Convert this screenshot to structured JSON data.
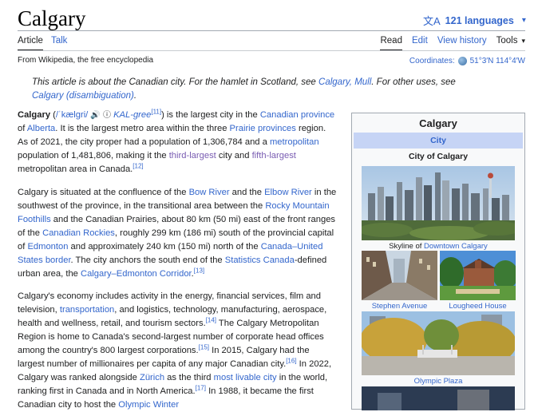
{
  "page": {
    "title": "Calgary",
    "languages_label": "121 languages",
    "tabs_left": [
      "Article",
      "Talk"
    ],
    "tabs_right": [
      "Read",
      "Edit",
      "View history"
    ],
    "tools_label": "Tools",
    "tagline": "From Wikipedia, the free encyclopedia",
    "coordinates_label": "Coordinates:",
    "coordinates_value": "51°3′N 114°4′W"
  },
  "hatnote": {
    "t1": "This article is about the Canadian city. For the hamlet in Scotland, see ",
    "l1": "Calgary, Mull",
    "t2": ". For other uses, see ",
    "l2": "Calgary (disambiguation)",
    "t3": "."
  },
  "para1": {
    "bold": "Calgary",
    "t1": " (",
    "ipa": "/ˈkælɡri/",
    "t2": " ",
    "pron": "KAL-gree",
    "ref1": "[11]",
    "t3": ") is the largest city in the ",
    "l1": "Canadian province",
    "t4": " of ",
    "l2": "Alberta",
    "t5": ". It is the largest metro area within the three ",
    "l3": "Prairie provinces",
    "t6": " region. As of 2021, the city proper had a population of 1,306,784 and a ",
    "l4": "metropolitan",
    "t7": " population of 1,481,806, making it the ",
    "l5": "third-largest",
    "t8": " city and ",
    "l6": "fifth-largest",
    "t9": " metropolitan area in Canada.",
    "ref2": "[12]"
  },
  "para2": {
    "t1": "Calgary is situated at the confluence of the ",
    "l1": "Bow River",
    "t2": " and the ",
    "l2": "Elbow River",
    "t3": " in the southwest of the province, in the transitional area between the ",
    "l3": "Rocky Mountain Foothills",
    "t4": " and the Canadian Prairies, about 80 km (50 mi) east of the front ranges of the ",
    "l4": "Canadian Rockies",
    "t5": ", roughly 299 km (186 mi) south of the provincial capital of ",
    "l5": "Edmonton",
    "t6": " and approximately 240 km (150 mi) north of the ",
    "l6": "Canada–United States border",
    "t7": ". The city anchors the south end of the ",
    "l7": "Statistics Canada",
    "t8": "-defined urban area, the ",
    "l8": "Calgary–Edmonton Corridor",
    "t9": ".",
    "ref1": "[13]"
  },
  "para3": {
    "t1": "Calgary's economy includes activity in the energy, financial services, film and television, ",
    "l1": "transportation",
    "t2": ", and logistics, technology, manufacturing, aerospace, health and wellness, retail, and tourism sectors.",
    "ref1": "[14]",
    "t3": " The Calgary Metropolitan Region is home to Canada's second-largest number of corporate head offices among the country's 800 largest corporations.",
    "ref2": "[15]",
    "t4": " In 2015, Calgary had the largest number of millionaires per capita of any major Canadian city.",
    "ref3": "[16]",
    "t5": " In 2022, Calgary was ranked alongside ",
    "l2": "Zürich",
    "t6": " as the third ",
    "l3": "most livable city",
    "t7": " in the world, ranking first in Canada and in North America.",
    "ref4": "[17]",
    "t8": " In 1988, it became the first Canadian city to host the ",
    "l4": "Olympic Winter"
  },
  "infobox": {
    "title": "Calgary",
    "type": "City",
    "name": "City of Calgary",
    "cap1_text": "Skyline of ",
    "cap1_link": "Downtown Calgary",
    "cap2": "Stephen Avenue",
    "cap3": "Lougheed House",
    "cap4": "Olympic Plaza"
  }
}
